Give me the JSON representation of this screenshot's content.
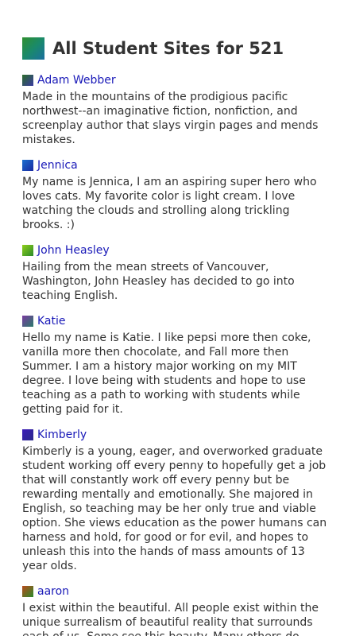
{
  "page": {
    "title": "All Student Sites for 521"
  },
  "colors": {
    "link": "#1a1ab8",
    "text": "#333333"
  },
  "students": [
    {
      "name": "Adam Webber",
      "icon": "avatar-gradient-icon",
      "icon_colors": [
        "#2a6b2a",
        "#3a3aa0"
      ],
      "bio": "Made in the mountains of the prodigious pacific northwest--an imaginative fiction, nonfiction, and screenplay author that slays virgin pages and mends mistakes."
    },
    {
      "name": "Jennica",
      "icon": "avatar-gradient-icon",
      "icon_colors": [
        "#1a6fcf",
        "#1a2aa0"
      ],
      "bio": "My name is Jennica, I am an aspiring super hero who loves cats. My favorite color is light cream. I love watching the clouds and strolling along trickling brooks. :)"
    },
    {
      "name": "John Heasley",
      "icon": "avatar-gradient-icon",
      "icon_colors": [
        "#8fcf1a",
        "#2a8a2a"
      ],
      "bio": "Hailing from the mean streets of Vancouver, Washington, John Heasley has decided to go into teaching English."
    },
    {
      "name": "Katie",
      "icon": "avatar-gradient-icon",
      "icon_colors": [
        "#7a3aa0",
        "#2a7a6a"
      ],
      "bio": "Hello my name is Katie. I like pepsi more then coke, vanilla more then chocolate, and Fall more then Summer. I am a history major working on my MIT degree. I love being with students and hope to use teaching as a path to working with students while getting paid for it."
    },
    {
      "name": "Kimberly",
      "icon": "avatar-gradient-icon",
      "icon_colors": [
        "#3a1ab8",
        "#2a2a8a"
      ],
      "bio": "Kimberly is a young, eager, and overworked graduate student working off every penny to hopefully get a job that will constantly work off every penny but be rewarding mentally and emotionally. She majored in English, so teaching may be her only true and viable option. She views education as the power humans can harness and hold, for good or for evil, and hopes to unleash this into the hands of mass amounts of 13 year olds."
    },
    {
      "name": "aaron",
      "icon": "avatar-gradient-icon",
      "icon_colors": [
        "#b84a1a",
        "#2a8a2a"
      ],
      "bio": "I exist within the beautiful. All people exist within the unique surrealism of beautiful reality that surrounds each of us. Some see this beauty. Many others do"
    }
  ]
}
